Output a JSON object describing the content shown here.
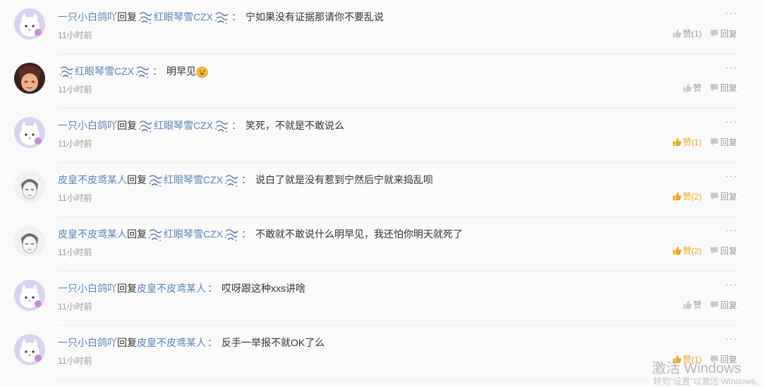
{
  "comments": [
    {
      "author": "一只小白鸽吖",
      "reply_word": "回复",
      "reply_to": "红眼琴雪CZX",
      "text": "宁如果没有证据那请你不要乱说",
      "time": "11小时前",
      "like_label": "赞(1)",
      "liked": false,
      "reply_label": "回复",
      "avatar": "cat-avatar"
    },
    {
      "author": "红眼琴雪CZX",
      "reply_word": "",
      "reply_to": "",
      "text": "明早见",
      "emoji": "face-tongue-emoji",
      "time": "11小时前",
      "like_label": "赞",
      "liked": false,
      "reply_label": "回复",
      "avatar": "anime-avatar"
    },
    {
      "author": "一只小白鸽吖",
      "reply_word": "回复",
      "reply_to": "红眼琴雪CZX",
      "text": "笑死，不就是不敢说么",
      "time": "11小时前",
      "like_label": "赞(1)",
      "liked": true,
      "reply_label": "回复",
      "avatar": "cat-avatar"
    },
    {
      "author": "皮皇不皮鸢某人",
      "reply_word": "回复",
      "reply_to": "红眼琴雪CZX",
      "text": "说白了就是没有惹到宁然后宁就来捣乱呗",
      "time": "11小时前",
      "like_label": "赞(2)",
      "liked": true,
      "reply_label": "回复",
      "avatar": "sketch-avatar"
    },
    {
      "author": "皮皇不皮鸢某人",
      "reply_word": "回复",
      "reply_to": "红眼琴雪CZX",
      "text": "不敢就不敢说什么明早见，我还怕你明天就死了",
      "time": "11小时前",
      "like_label": "赞(2)",
      "liked": true,
      "reply_label": "回复",
      "avatar": "sketch-avatar"
    },
    {
      "author": "一只小白鸽吖",
      "reply_word": "回复",
      "reply_to": "皮皇不皮鸢某人",
      "text": "哎呀跟这种xxs讲啥",
      "time": "11小时前",
      "like_label": "赞",
      "liked": false,
      "reply_label": "回复",
      "avatar": "cat-avatar"
    },
    {
      "author": "一只小白鸽吖",
      "reply_word": "回复",
      "reply_to": "皮皇不皮鸢某人",
      "text": "反手一举报不就OK了么",
      "time": "11小时前",
      "like_label": "赞(1)",
      "liked": true,
      "reply_label": "回复",
      "avatar": "cat-avatar"
    }
  ],
  "more_label": "···",
  "colon": "：",
  "watermark": {
    "line1": "激活 Windows",
    "line2": "转到\"设置\"以激活 Windows。"
  },
  "colors": {
    "link": "#5b84b8",
    "liked": "#f0a61f",
    "muted": "#999999"
  }
}
